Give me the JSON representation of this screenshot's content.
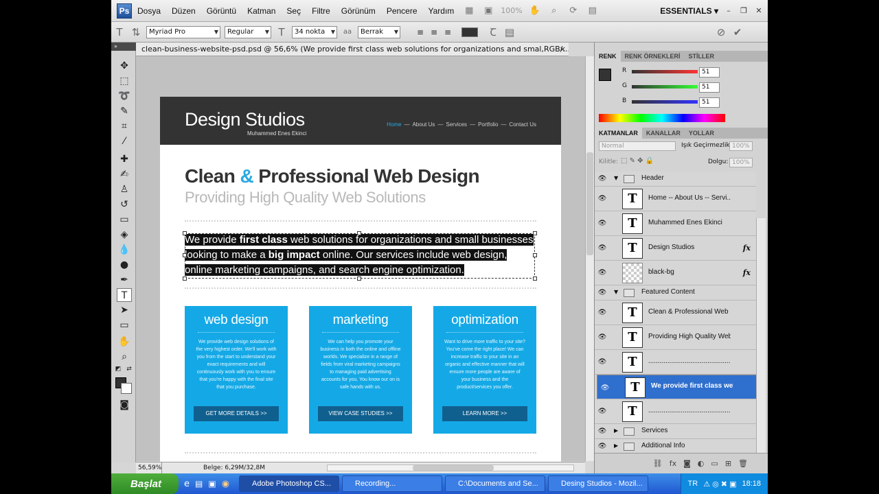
{
  "menubar": {
    "logo": "Ps",
    "items": [
      "Dosya",
      "Düzen",
      "Görüntü",
      "Katman",
      "Seç",
      "Filtre",
      "Görünüm",
      "Pencere",
      "Yardım"
    ],
    "zoom": "100%",
    "workspace": "ESSENTIALS ▾"
  },
  "options": {
    "font_family": "Myriad Pro",
    "font_style": "Regular",
    "font_size": "34 nokta",
    "antialias": "Berrak",
    "text_color": "#333333"
  },
  "document": {
    "tab_title": "clean-business-website-psd.psd @ 56,6% (We provide first class web solutions for organizations and smal,RGB/...",
    "close": "×"
  },
  "site": {
    "title": "Design Studios",
    "subtitle": "Muhammed Enes Ekinci",
    "nav": [
      "Home",
      "About Us",
      "Services",
      "Portfolio",
      "Contact Us"
    ],
    "nav_sep": "—",
    "headline_a": "Clean ",
    "headline_amp": "&",
    "headline_b": " Professional Web Design",
    "subline": "Providing High Quality Web Solutions",
    "intro_1": "We provide ",
    "intro_b1": "first class",
    "intro_2": " web solutions for organizations and small businesses looking to make a ",
    "intro_b2": "big impact",
    "intro_3": " online. Our services include web design, online marketing campaigns, and search engine optimization.",
    "boxes": [
      {
        "title": "web design",
        "text": "We provide web design solutions of the very highest order. We'll work with you from the start to understand your exact requirements and will continuously work with you to ensure that you're happy with the final site that you purchase.",
        "button": "GET MORE DETAILS >>"
      },
      {
        "title": "marketing",
        "text": "We can help you promote your business in both the online and offline worlds. We specialize in a range of fields from viral marketing campaigns to managing paid advertising accounts for you. You know our on is safe hands with us.",
        "button": "VIEW CASE STUDIES >>"
      },
      {
        "title": "optimization",
        "text": "Want to drive more traffic to your site? You've come the right place! We can increase traffic to your site in an organic and effective manner that will ensure more people are aware of your business and the product/services you offer.",
        "button": "LEARN MORE >>"
      }
    ]
  },
  "status": {
    "zoom": "56,59%",
    "doc": "Belge: 6,29M/32,8M"
  },
  "color_panel": {
    "tabs": [
      "RENK",
      "RENK ÖRNEKLERİ",
      "STİLLER"
    ],
    "r_label": "R",
    "g_label": "G",
    "b_label": "B",
    "r": "51",
    "g": "51",
    "b": "51",
    "fg_color": "#333333"
  },
  "layers_panel": {
    "tabs": [
      "KATMANLAR",
      "KANALLAR",
      "YOLLAR"
    ],
    "blend": "Normal",
    "opacity_label": "Işık Geçirmezlik:",
    "opacity": "100%",
    "lock_label": "Kilitle:",
    "fill_label": "Dolgu:",
    "fill": "100%",
    "layers": [
      {
        "name": "Header",
        "type": "group"
      },
      {
        "name": "Home -- About Us -- Servi...",
        "type": "text"
      },
      {
        "name": "Muhammed Enes Ekinci",
        "type": "text"
      },
      {
        "name": "Design Studios",
        "type": "text",
        "fx": "fx"
      },
      {
        "name": "black-bg",
        "type": "raster",
        "fx": "fx"
      },
      {
        "name": "Featured Content",
        "type": "group"
      },
      {
        "name": "Clean & Professional Web Design",
        "type": "text"
      },
      {
        "name": "Providing High Quality Web Sol...",
        "type": "text"
      },
      {
        "name": "...........................................",
        "type": "text"
      },
      {
        "name": "We provide first class web s...",
        "type": "text",
        "selected": true
      },
      {
        "name": "...........................................",
        "type": "text"
      },
      {
        "name": "Services",
        "type": "group"
      },
      {
        "name": "Additional Info",
        "type": "group"
      }
    ]
  },
  "taskbar": {
    "start": "Başlat",
    "tasks": [
      "Adobe Photoshop CS...",
      "Recording...",
      "C:\\Documents and Se...",
      "Desing Studios - Mozil..."
    ],
    "lang": "TR",
    "clock": "18:18"
  }
}
